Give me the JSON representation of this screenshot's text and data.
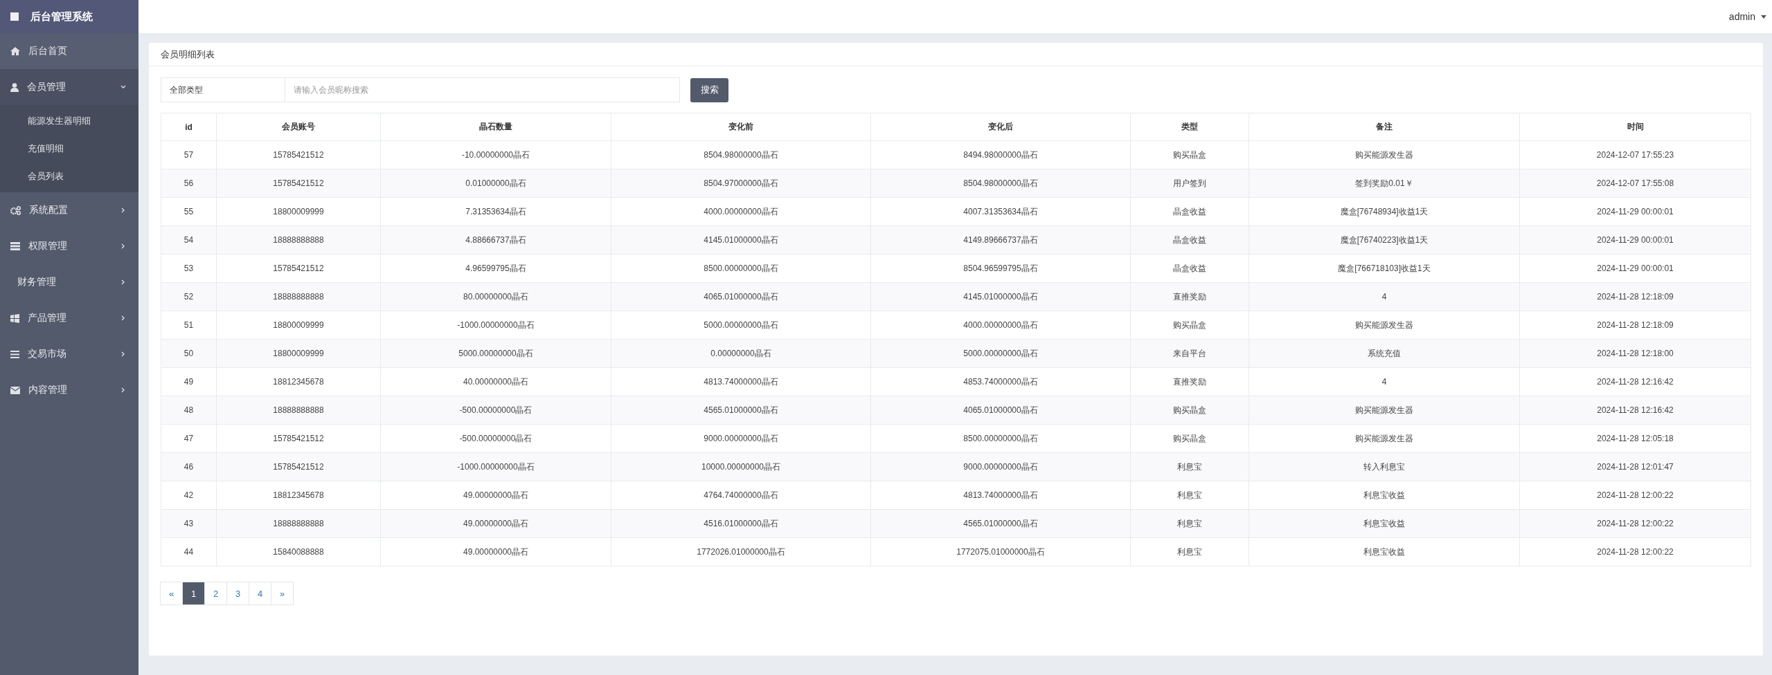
{
  "brand": {
    "title": "后台管理系统"
  },
  "sidebar": {
    "items": [
      {
        "label": "后台首页",
        "kind": "home"
      },
      {
        "label": "会员管理",
        "kind": "user",
        "expanded": true,
        "children": [
          {
            "label": "能源发生器明细"
          },
          {
            "label": "充值明细"
          },
          {
            "label": "会员列表"
          }
        ]
      },
      {
        "label": "系统配置",
        "kind": "gears",
        "expanded": false
      },
      {
        "label": "权限管理",
        "kind": "list",
        "expanded": false
      },
      {
        "label": "财务管理",
        "kind": "plain",
        "expanded": false
      },
      {
        "label": "产品管理",
        "kind": "windows",
        "expanded": false
      },
      {
        "label": "交易市场",
        "kind": "bars",
        "expanded": false
      },
      {
        "label": "内容管理",
        "kind": "mail",
        "expanded": false
      }
    ]
  },
  "header": {
    "user": "admin"
  },
  "panel": {
    "title": "会员明细列表"
  },
  "filters": {
    "type_select": "全部类型",
    "search": {
      "placeholder": "请输入会员昵称搜索"
    },
    "button": "搜索"
  },
  "table": {
    "columns": [
      "id",
      "会员账号",
      "晶石数量",
      "变化前",
      "变化后",
      "类型",
      "备注",
      "时间"
    ],
    "rows": [
      [
        "57",
        "15785421512",
        "-10.00000000晶石",
        "8504.98000000晶石",
        "8494.98000000晶石",
        "购买晶盒",
        "购买能源发生器",
        "2024-12-07 17:55:23"
      ],
      [
        "56",
        "15785421512",
        "0.01000000晶石",
        "8504.97000000晶石",
        "8504.98000000晶石",
        "用户签到",
        "签到奖励0.01￥",
        "2024-12-07 17:55:08"
      ],
      [
        "55",
        "18800009999",
        "7.31353634晶石",
        "4000.00000000晶石",
        "4007.31353634晶石",
        "晶盒收益",
        "魔盒[76748934]收益1天",
        "2024-11-29 00:00:01"
      ],
      [
        "54",
        "18888888888",
        "4.88666737晶石",
        "4145.01000000晶石",
        "4149.89666737晶石",
        "晶盒收益",
        "魔盒[76740223]收益1天",
        "2024-11-29 00:00:01"
      ],
      [
        "53",
        "15785421512",
        "4.96599795晶石",
        "8500.00000000晶石",
        "8504.96599795晶石",
        "晶盒收益",
        "魔盒[766718103]收益1天",
        "2024-11-29 00:00:01"
      ],
      [
        "52",
        "18888888888",
        "80.00000000晶石",
        "4065.01000000晶石",
        "4145.01000000晶石",
        "直推奖励",
        "4",
        "2024-11-28 12:18:09"
      ],
      [
        "51",
        "18800009999",
        "-1000.00000000晶石",
        "5000.00000000晶石",
        "4000.00000000晶石",
        "购买晶盒",
        "购买能源发生器",
        "2024-11-28 12:18:09"
      ],
      [
        "50",
        "18800009999",
        "5000.00000000晶石",
        "0.00000000晶石",
        "5000.00000000晶石",
        "来自平台",
        "系统充值",
        "2024-11-28 12:18:00"
      ],
      [
        "49",
        "18812345678",
        "40.00000000晶石",
        "4813.74000000晶石",
        "4853.74000000晶石",
        "直推奖励",
        "4",
        "2024-11-28 12:16:42"
      ],
      [
        "48",
        "18888888888",
        "-500.00000000晶石",
        "4565.01000000晶石",
        "4065.01000000晶石",
        "购买晶盒",
        "购买能源发生器",
        "2024-11-28 12:16:42"
      ],
      [
        "47",
        "15785421512",
        "-500.00000000晶石",
        "9000.00000000晶石",
        "8500.00000000晶石",
        "购买晶盒",
        "购买能源发生器",
        "2024-11-28 12:05:18"
      ],
      [
        "46",
        "15785421512",
        "-1000.00000000晶石",
        "10000.00000000晶石",
        "9000.00000000晶石",
        "利息宝",
        "转入利息宝",
        "2024-11-28 12:01:47"
      ],
      [
        "42",
        "18812345678",
        "49.00000000晶石",
        "4764.74000000晶石",
        "4813.74000000晶石",
        "利息宝",
        "利息宝收益",
        "2024-11-28 12:00:22"
      ],
      [
        "43",
        "18888888888",
        "49.00000000晶石",
        "4516.01000000晶石",
        "4565.01000000晶石",
        "利息宝",
        "利息宝收益",
        "2024-11-28 12:00:22"
      ],
      [
        "44",
        "15840088888",
        "49.00000000晶石",
        "1772026.01000000晶石",
        "1772075.01000000晶石",
        "利息宝",
        "利息宝收益",
        "2024-11-28 12:00:22"
      ]
    ]
  },
  "pagination": [
    {
      "label": "«",
      "selected": false
    },
    {
      "label": "1",
      "selected": true
    },
    {
      "label": "2",
      "selected": false
    },
    {
      "label": "3",
      "selected": false
    },
    {
      "label": "4",
      "selected": false
    },
    {
      "label": "»",
      "selected": false
    }
  ]
}
